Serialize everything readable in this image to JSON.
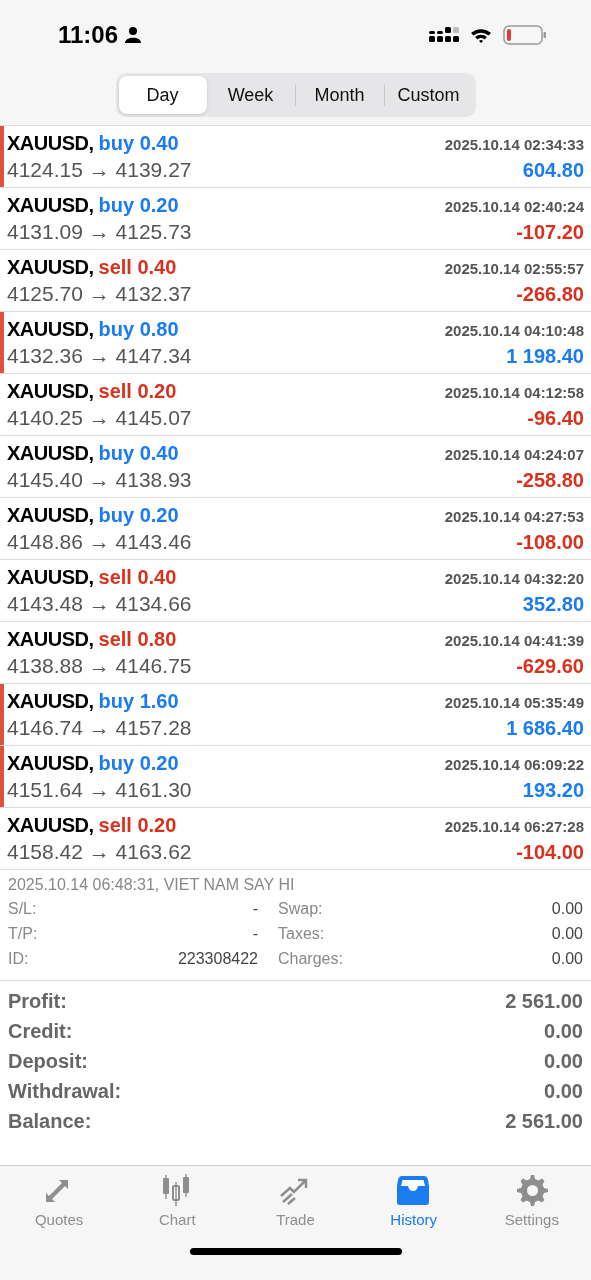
{
  "status_bar": {
    "time": "11:06"
  },
  "period_tabs": [
    {
      "label": "Day",
      "selected": true
    },
    {
      "label": "Week",
      "selected": false
    },
    {
      "label": "Month",
      "selected": false
    },
    {
      "label": "Custom",
      "selected": false
    }
  ],
  "deals": [
    {
      "symbol": "XAUUSD,",
      "order": "buy 0.40",
      "kind": "buy",
      "prices": "4124.15 → 4139.27",
      "time": "2025.10.14 02:34:33",
      "profit": "604.80",
      "loss": false,
      "marked": true
    },
    {
      "symbol": "XAUUSD,",
      "order": "buy 0.20",
      "kind": "buy",
      "prices": "4131.09 → 4125.73",
      "time": "2025.10.14 02:40:24",
      "profit": "-107.20",
      "loss": true,
      "marked": false
    },
    {
      "symbol": "XAUUSD,",
      "order": "sell 0.40",
      "kind": "sell",
      "prices": "4125.70 → 4132.37",
      "time": "2025.10.14 02:55:57",
      "profit": "-266.80",
      "loss": true,
      "marked": false
    },
    {
      "symbol": "XAUUSD,",
      "order": "buy 0.80",
      "kind": "buy",
      "prices": "4132.36 → 4147.34",
      "time": "2025.10.14 04:10:48",
      "profit": "1 198.40",
      "loss": false,
      "marked": true
    },
    {
      "symbol": "XAUUSD,",
      "order": "sell 0.20",
      "kind": "sell",
      "prices": "4140.25 → 4145.07",
      "time": "2025.10.14 04:12:58",
      "profit": "-96.40",
      "loss": true,
      "marked": false
    },
    {
      "symbol": "XAUUSD,",
      "order": "buy 0.40",
      "kind": "buy",
      "prices": "4145.40 → 4138.93",
      "time": "2025.10.14 04:24:07",
      "profit": "-258.80",
      "loss": true,
      "marked": false
    },
    {
      "symbol": "XAUUSD,",
      "order": "buy 0.20",
      "kind": "buy",
      "prices": "4148.86 → 4143.46",
      "time": "2025.10.14 04:27:53",
      "profit": "-108.00",
      "loss": true,
      "marked": false
    },
    {
      "symbol": "XAUUSD,",
      "order": "sell 0.40",
      "kind": "sell",
      "prices": "4143.48 → 4134.66",
      "time": "2025.10.14 04:32:20",
      "profit": "352.80",
      "loss": false,
      "marked": false
    },
    {
      "symbol": "XAUUSD,",
      "order": "sell 0.80",
      "kind": "sell",
      "prices": "4138.88 → 4146.75",
      "time": "2025.10.14 04:41:39",
      "profit": "-629.60",
      "loss": true,
      "marked": false
    },
    {
      "symbol": "XAUUSD,",
      "order": "buy 1.60",
      "kind": "buy",
      "prices": "4146.74 → 4157.28",
      "time": "2025.10.14 05:35:49",
      "profit": "1 686.40",
      "loss": false,
      "marked": true
    },
    {
      "symbol": "XAUUSD,",
      "order": "buy 0.20",
      "kind": "buy",
      "prices": "4151.64 → 4161.30",
      "time": "2025.10.14 06:09:22",
      "profit": "193.20",
      "loss": false,
      "marked": true
    },
    {
      "symbol": "XAUUSD,",
      "order": "sell 0.20",
      "kind": "sell",
      "prices": "4158.42 → 4163.62",
      "time": "2025.10.14 06:27:28",
      "profit": "-104.00",
      "loss": true,
      "marked": false
    }
  ],
  "deal_details": {
    "header": "2025.10.14 06:48:31, VIET NAM SAY HI",
    "fields": [
      {
        "label": "S/L:",
        "value": "-"
      },
      {
        "label": "Swap:",
        "value": "0.00"
      },
      {
        "label": "T/P:",
        "value": "-"
      },
      {
        "label": "Taxes:",
        "value": "0.00"
      },
      {
        "label": "ID:",
        "value": "223308422"
      },
      {
        "label": "Charges:",
        "value": "0.00"
      }
    ]
  },
  "summary": [
    {
      "label": "Profit:",
      "value": "2 561.00"
    },
    {
      "label": "Credit:",
      "value": "0.00"
    },
    {
      "label": "Deposit:",
      "value": "0.00"
    },
    {
      "label": "Withdrawal:",
      "value": "0.00"
    },
    {
      "label": "Balance:",
      "value": "2 561.00"
    }
  ],
  "tab_bar": [
    {
      "label": "Quotes",
      "kind": "quotes",
      "selected": false
    },
    {
      "label": "Chart",
      "kind": "chart",
      "selected": false
    },
    {
      "label": "Trade",
      "kind": "trade",
      "selected": false
    },
    {
      "label": "History",
      "kind": "history",
      "selected": true
    },
    {
      "label": "Settings",
      "kind": "settings",
      "selected": false
    }
  ]
}
